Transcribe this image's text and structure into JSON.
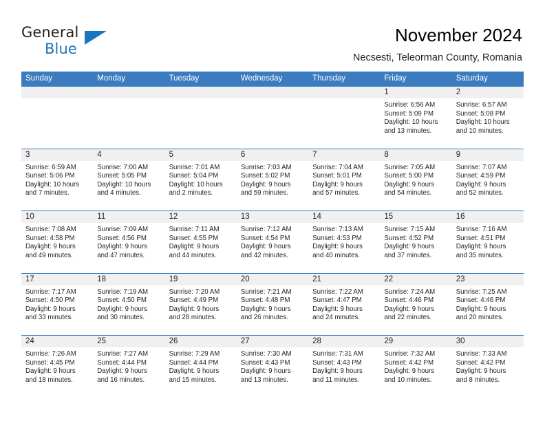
{
  "brand": {
    "name_part1": "General",
    "name_part2": "Blue",
    "accent_color": "#1b75bb"
  },
  "header": {
    "title": "November 2024",
    "subtitle": "Necsesti, Teleorman County, Romania"
  },
  "calendar": {
    "header_color": "#3b7cc0",
    "weekday_headers": [
      "Sunday",
      "Monday",
      "Tuesday",
      "Wednesday",
      "Thursday",
      "Friday",
      "Saturday"
    ],
    "weeks": [
      [
        {
          "day": ""
        },
        {
          "day": ""
        },
        {
          "day": ""
        },
        {
          "day": ""
        },
        {
          "day": ""
        },
        {
          "day": "1",
          "sunrise": "Sunrise: 6:56 AM",
          "sunset": "Sunset: 5:09 PM",
          "daylight1": "Daylight: 10 hours",
          "daylight2": "and 13 minutes."
        },
        {
          "day": "2",
          "sunrise": "Sunrise: 6:57 AM",
          "sunset": "Sunset: 5:08 PM",
          "daylight1": "Daylight: 10 hours",
          "daylight2": "and 10 minutes."
        }
      ],
      [
        {
          "day": "3",
          "sunrise": "Sunrise: 6:59 AM",
          "sunset": "Sunset: 5:06 PM",
          "daylight1": "Daylight: 10 hours",
          "daylight2": "and 7 minutes."
        },
        {
          "day": "4",
          "sunrise": "Sunrise: 7:00 AM",
          "sunset": "Sunset: 5:05 PM",
          "daylight1": "Daylight: 10 hours",
          "daylight2": "and 4 minutes."
        },
        {
          "day": "5",
          "sunrise": "Sunrise: 7:01 AM",
          "sunset": "Sunset: 5:04 PM",
          "daylight1": "Daylight: 10 hours",
          "daylight2": "and 2 minutes."
        },
        {
          "day": "6",
          "sunrise": "Sunrise: 7:03 AM",
          "sunset": "Sunset: 5:02 PM",
          "daylight1": "Daylight: 9 hours",
          "daylight2": "and 59 minutes."
        },
        {
          "day": "7",
          "sunrise": "Sunrise: 7:04 AM",
          "sunset": "Sunset: 5:01 PM",
          "daylight1": "Daylight: 9 hours",
          "daylight2": "and 57 minutes."
        },
        {
          "day": "8",
          "sunrise": "Sunrise: 7:05 AM",
          "sunset": "Sunset: 5:00 PM",
          "daylight1": "Daylight: 9 hours",
          "daylight2": "and 54 minutes."
        },
        {
          "day": "9",
          "sunrise": "Sunrise: 7:07 AM",
          "sunset": "Sunset: 4:59 PM",
          "daylight1": "Daylight: 9 hours",
          "daylight2": "and 52 minutes."
        }
      ],
      [
        {
          "day": "10",
          "sunrise": "Sunrise: 7:08 AM",
          "sunset": "Sunset: 4:58 PM",
          "daylight1": "Daylight: 9 hours",
          "daylight2": "and 49 minutes."
        },
        {
          "day": "11",
          "sunrise": "Sunrise: 7:09 AM",
          "sunset": "Sunset: 4:56 PM",
          "daylight1": "Daylight: 9 hours",
          "daylight2": "and 47 minutes."
        },
        {
          "day": "12",
          "sunrise": "Sunrise: 7:11 AM",
          "sunset": "Sunset: 4:55 PM",
          "daylight1": "Daylight: 9 hours",
          "daylight2": "and 44 minutes."
        },
        {
          "day": "13",
          "sunrise": "Sunrise: 7:12 AM",
          "sunset": "Sunset: 4:54 PM",
          "daylight1": "Daylight: 9 hours",
          "daylight2": "and 42 minutes."
        },
        {
          "day": "14",
          "sunrise": "Sunrise: 7:13 AM",
          "sunset": "Sunset: 4:53 PM",
          "daylight1": "Daylight: 9 hours",
          "daylight2": "and 40 minutes."
        },
        {
          "day": "15",
          "sunrise": "Sunrise: 7:15 AM",
          "sunset": "Sunset: 4:52 PM",
          "daylight1": "Daylight: 9 hours",
          "daylight2": "and 37 minutes."
        },
        {
          "day": "16",
          "sunrise": "Sunrise: 7:16 AM",
          "sunset": "Sunset: 4:51 PM",
          "daylight1": "Daylight: 9 hours",
          "daylight2": "and 35 minutes."
        }
      ],
      [
        {
          "day": "17",
          "sunrise": "Sunrise: 7:17 AM",
          "sunset": "Sunset: 4:50 PM",
          "daylight1": "Daylight: 9 hours",
          "daylight2": "and 33 minutes."
        },
        {
          "day": "18",
          "sunrise": "Sunrise: 7:19 AM",
          "sunset": "Sunset: 4:50 PM",
          "daylight1": "Daylight: 9 hours",
          "daylight2": "and 30 minutes."
        },
        {
          "day": "19",
          "sunrise": "Sunrise: 7:20 AM",
          "sunset": "Sunset: 4:49 PM",
          "daylight1": "Daylight: 9 hours",
          "daylight2": "and 28 minutes."
        },
        {
          "day": "20",
          "sunrise": "Sunrise: 7:21 AM",
          "sunset": "Sunset: 4:48 PM",
          "daylight1": "Daylight: 9 hours",
          "daylight2": "and 26 minutes."
        },
        {
          "day": "21",
          "sunrise": "Sunrise: 7:22 AM",
          "sunset": "Sunset: 4:47 PM",
          "daylight1": "Daylight: 9 hours",
          "daylight2": "and 24 minutes."
        },
        {
          "day": "22",
          "sunrise": "Sunrise: 7:24 AM",
          "sunset": "Sunset: 4:46 PM",
          "daylight1": "Daylight: 9 hours",
          "daylight2": "and 22 minutes."
        },
        {
          "day": "23",
          "sunrise": "Sunrise: 7:25 AM",
          "sunset": "Sunset: 4:46 PM",
          "daylight1": "Daylight: 9 hours",
          "daylight2": "and 20 minutes."
        }
      ],
      [
        {
          "day": "24",
          "sunrise": "Sunrise: 7:26 AM",
          "sunset": "Sunset: 4:45 PM",
          "daylight1": "Daylight: 9 hours",
          "daylight2": "and 18 minutes."
        },
        {
          "day": "25",
          "sunrise": "Sunrise: 7:27 AM",
          "sunset": "Sunset: 4:44 PM",
          "daylight1": "Daylight: 9 hours",
          "daylight2": "and 16 minutes."
        },
        {
          "day": "26",
          "sunrise": "Sunrise: 7:29 AM",
          "sunset": "Sunset: 4:44 PM",
          "daylight1": "Daylight: 9 hours",
          "daylight2": "and 15 minutes."
        },
        {
          "day": "27",
          "sunrise": "Sunrise: 7:30 AM",
          "sunset": "Sunset: 4:43 PM",
          "daylight1": "Daylight: 9 hours",
          "daylight2": "and 13 minutes."
        },
        {
          "day": "28",
          "sunrise": "Sunrise: 7:31 AM",
          "sunset": "Sunset: 4:43 PM",
          "daylight1": "Daylight: 9 hours",
          "daylight2": "and 11 minutes."
        },
        {
          "day": "29",
          "sunrise": "Sunrise: 7:32 AM",
          "sunset": "Sunset: 4:42 PM",
          "daylight1": "Daylight: 9 hours",
          "daylight2": "and 10 minutes."
        },
        {
          "day": "30",
          "sunrise": "Sunrise: 7:33 AM",
          "sunset": "Sunset: 4:42 PM",
          "daylight1": "Daylight: 9 hours",
          "daylight2": "and 8 minutes."
        }
      ]
    ]
  }
}
